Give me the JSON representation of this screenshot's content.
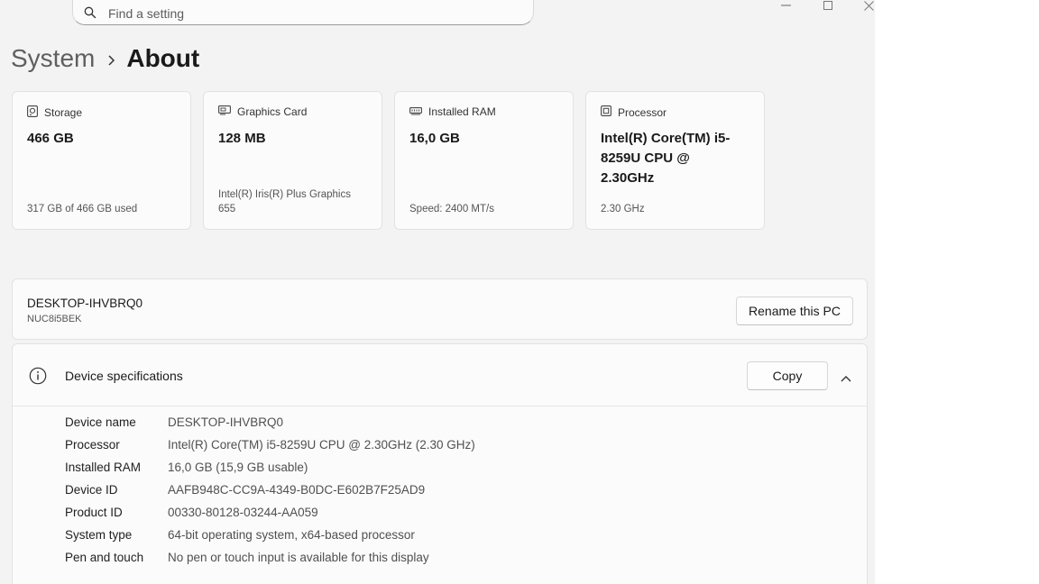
{
  "search": {
    "placeholder": "Find a setting"
  },
  "breadcrumb": {
    "parent": "System",
    "current": "About"
  },
  "cards": [
    {
      "icon": "storage-icon",
      "label": "Storage",
      "value": "466 GB",
      "sub": "317 GB of 466 GB used"
    },
    {
      "icon": "graphics-card-icon",
      "label": "Graphics Card",
      "value": "128 MB",
      "sub": "Intel(R) Iris(R) Plus Graphics 655"
    },
    {
      "icon": "ram-icon",
      "label": "Installed RAM",
      "value": "16,0 GB",
      "sub": "Speed: 2400 MT/s"
    },
    {
      "icon": "processor-icon",
      "label": "Processor",
      "value": "Intel(R) Core(TM) i5-8259U CPU @ 2.30GHz",
      "sub": "2.30 GHz"
    }
  ],
  "pc": {
    "name": "DESKTOP-IHVBRQ0",
    "model": "NUC8i5BEK",
    "rename_label": "Rename this PC"
  },
  "device_specs": {
    "title": "Device specifications",
    "copy_label": "Copy",
    "rows": [
      {
        "key": "Device name",
        "value": "DESKTOP-IHVBRQ0"
      },
      {
        "key": "Processor",
        "value": "Intel(R) Core(TM) i5-8259U CPU @ 2.30GHz (2.30 GHz)"
      },
      {
        "key": "Installed RAM",
        "value": "16,0 GB (15,9 GB usable)"
      },
      {
        "key": "Device ID",
        "value": "AAFB948C-CC9A-4349-B0DC-E602B7F25AD9"
      },
      {
        "key": "Product ID",
        "value": "00330-80128-03244-AA059"
      },
      {
        "key": "System type",
        "value": "64-bit operating system, x64-based processor"
      },
      {
        "key": "Pen and touch",
        "value": "No pen or touch input is available for this display"
      }
    ]
  }
}
